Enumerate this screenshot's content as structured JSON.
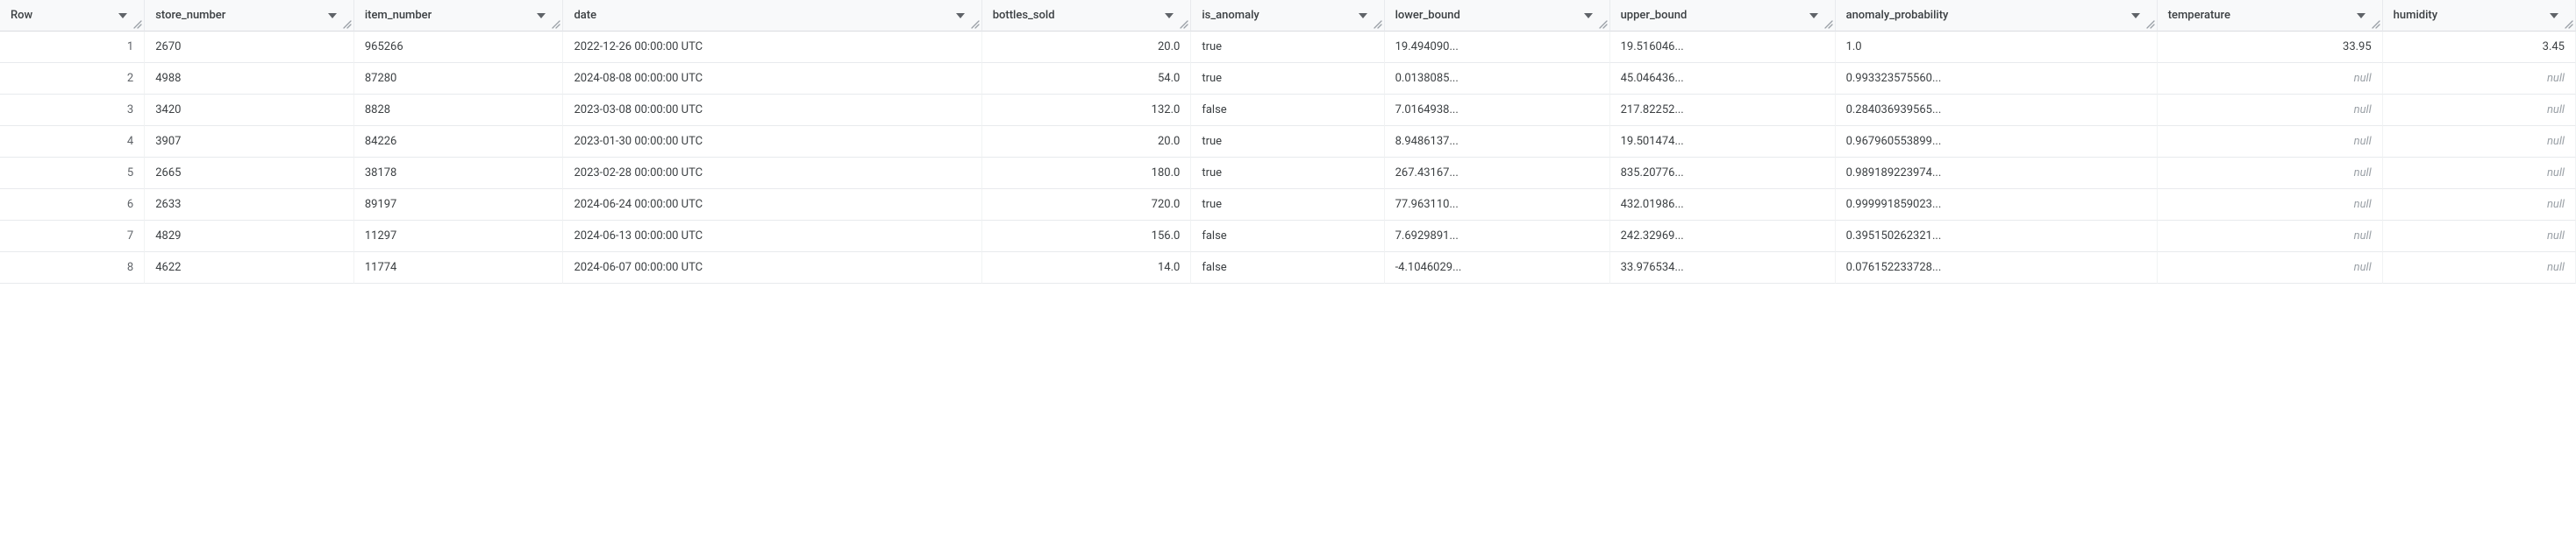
{
  "columns": [
    {
      "key": "row",
      "label": "Row",
      "align": "right"
    },
    {
      "key": "store_number",
      "label": "store_number",
      "align": "left"
    },
    {
      "key": "item_number",
      "label": "item_number",
      "align": "left"
    },
    {
      "key": "date",
      "label": "date",
      "align": "left"
    },
    {
      "key": "bottles_sold",
      "label": "bottles_sold",
      "align": "right"
    },
    {
      "key": "is_anomaly",
      "label": "is_anomaly",
      "align": "left"
    },
    {
      "key": "lower_bound",
      "label": "lower_bound",
      "align": "left"
    },
    {
      "key": "upper_bound",
      "label": "upper_bound",
      "align": "left"
    },
    {
      "key": "anomaly_probability",
      "label": "anomaly_probability",
      "align": "left"
    },
    {
      "key": "temperature",
      "label": "temperature",
      "align": "right"
    },
    {
      "key": "humidity",
      "label": "humidity",
      "align": "right"
    }
  ],
  "null_display": "null",
  "rows": [
    {
      "row": "1",
      "store_number": "2670",
      "item_number": "965266",
      "date": "2022-12-26 00:00:00 UTC",
      "bottles_sold": "20.0",
      "is_anomaly": "true",
      "lower_bound": "19.494090...",
      "upper_bound": "19.516046...",
      "anomaly_probability": "1.0",
      "temperature": "33.95",
      "humidity": "3.45"
    },
    {
      "row": "2",
      "store_number": "4988",
      "item_number": "87280",
      "date": "2024-08-08 00:00:00 UTC",
      "bottles_sold": "54.0",
      "is_anomaly": "true",
      "lower_bound": "0.0138085...",
      "upper_bound": "45.046436...",
      "anomaly_probability": "0.993323575560...",
      "temperature": null,
      "humidity": null
    },
    {
      "row": "3",
      "store_number": "3420",
      "item_number": "8828",
      "date": "2023-03-08 00:00:00 UTC",
      "bottles_sold": "132.0",
      "is_anomaly": "false",
      "lower_bound": "7.0164938...",
      "upper_bound": "217.82252...",
      "anomaly_probability": "0.284036939565...",
      "temperature": null,
      "humidity": null
    },
    {
      "row": "4",
      "store_number": "3907",
      "item_number": "84226",
      "date": "2023-01-30 00:00:00 UTC",
      "bottles_sold": "20.0",
      "is_anomaly": "true",
      "lower_bound": "8.9486137...",
      "upper_bound": "19.501474...",
      "anomaly_probability": "0.967960553899...",
      "temperature": null,
      "humidity": null
    },
    {
      "row": "5",
      "store_number": "2665",
      "item_number": "38178",
      "date": "2023-02-28 00:00:00 UTC",
      "bottles_sold": "180.0",
      "is_anomaly": "true",
      "lower_bound": "267.43167...",
      "upper_bound": "835.20776...",
      "anomaly_probability": "0.989189223974...",
      "temperature": null,
      "humidity": null
    },
    {
      "row": "6",
      "store_number": "2633",
      "item_number": "89197",
      "date": "2024-06-24 00:00:00 UTC",
      "bottles_sold": "720.0",
      "is_anomaly": "true",
      "lower_bound": "77.963110...",
      "upper_bound": "432.01986...",
      "anomaly_probability": "0.999991859023...",
      "temperature": null,
      "humidity": null
    },
    {
      "row": "7",
      "store_number": "4829",
      "item_number": "11297",
      "date": "2024-06-13 00:00:00 UTC",
      "bottles_sold": "156.0",
      "is_anomaly": "false",
      "lower_bound": "7.6929891...",
      "upper_bound": "242.32969...",
      "anomaly_probability": "0.395150262321...",
      "temperature": null,
      "humidity": null
    },
    {
      "row": "8",
      "store_number": "4622",
      "item_number": "11774",
      "date": "2024-06-07 00:00:00 UTC",
      "bottles_sold": "14.0",
      "is_anomaly": "false",
      "lower_bound": "-4.1046029...",
      "upper_bound": "33.976534...",
      "anomaly_probability": "0.076152233728...",
      "temperature": null,
      "humidity": null
    }
  ]
}
